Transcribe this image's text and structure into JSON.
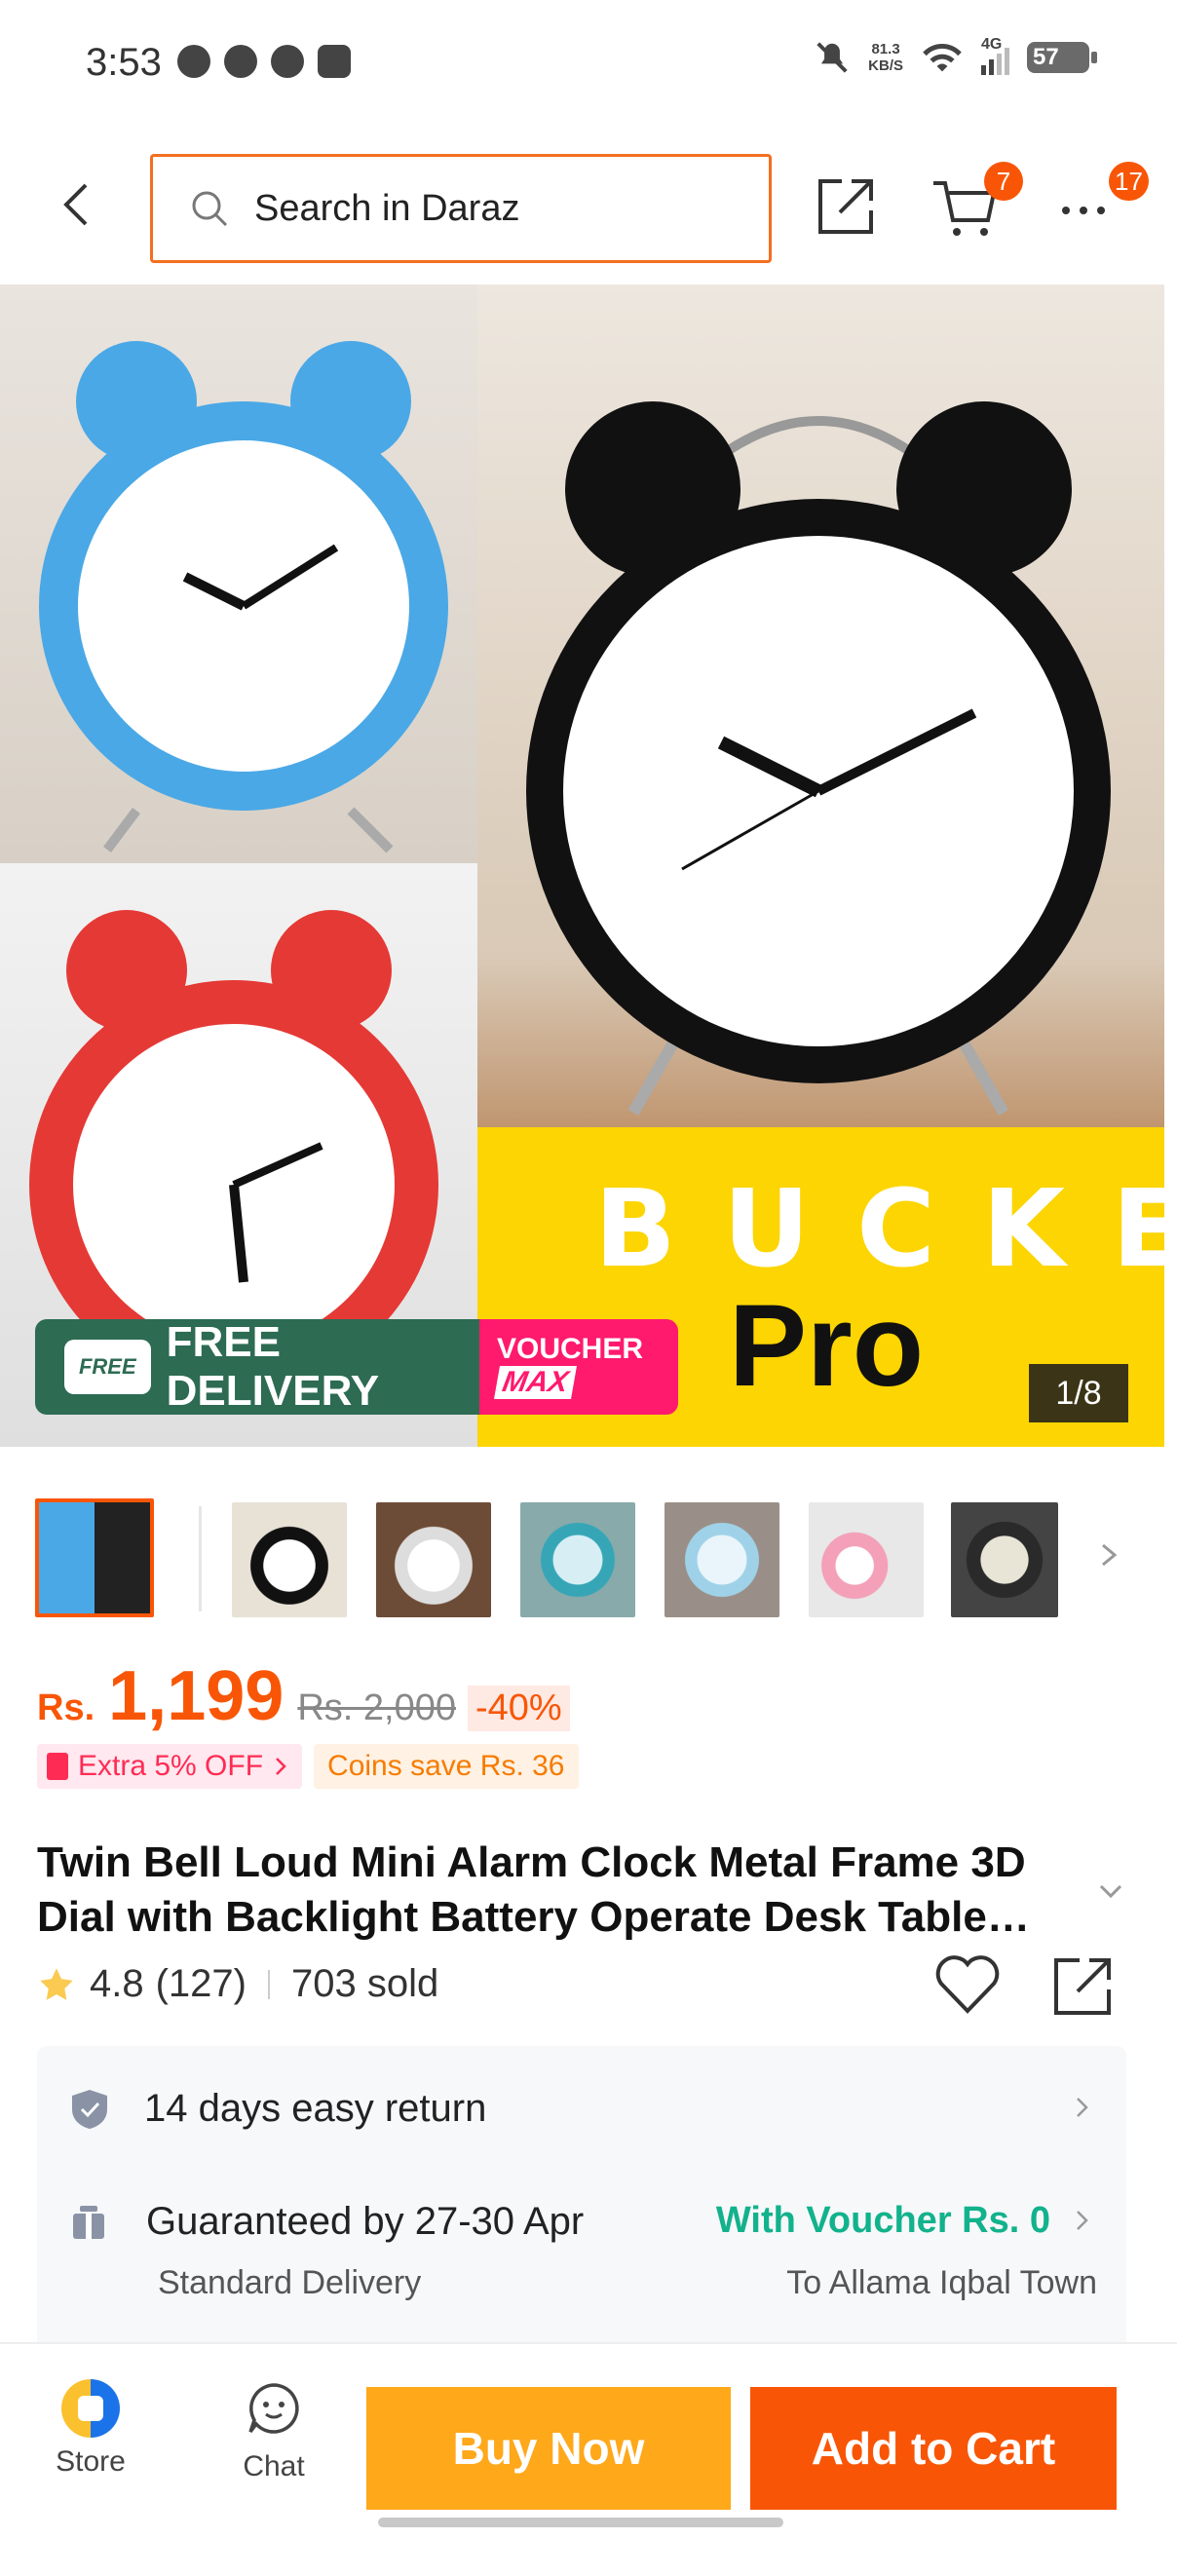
{
  "status_bar": {
    "time": "3:53",
    "net_speed_value": "81.3",
    "net_speed_unit": "KB/S",
    "network": "4G",
    "battery": "57"
  },
  "header": {
    "search_placeholder": "Search in Daraz",
    "cart_badge": "7",
    "more_badge": "17"
  },
  "gallery": {
    "banner_word": "BUCKET",
    "banner_sub": "Pro",
    "free_delivery_tag": "FREE",
    "free_delivery": "FREE DELIVERY",
    "voucher_line1": "VOUCHER",
    "voucher_line2": "MAX",
    "counter": "1/8"
  },
  "product": {
    "currency": "Rs.",
    "price": "1,199",
    "old_price": "Rs. 2,000",
    "discount": "-40%",
    "promo_extra": "Extra 5% OFF",
    "promo_coins": "Coins save Rs. 36",
    "title": "Twin Bell Loud Mini Alarm Clock Metal Frame 3D Dial with Backlight Battery Operate Desk Table Clock",
    "rating": "4.8",
    "reviews": "(127)",
    "sold": "703 sold"
  },
  "services": {
    "return_text": "14 days easy return",
    "delivery_text": "Guaranteed by 27-30 Apr",
    "voucher_text": "With Voucher Rs. 0",
    "delivery_type": "Standard Delivery",
    "location": "To Allama Iqbal Town"
  },
  "bottom_bar": {
    "store_label": "Store",
    "chat_label": "Chat",
    "buy_now": "Buy Now",
    "add_to_cart": "Add to Cart"
  },
  "colors": {
    "accent": "#f85606",
    "buy_now": "#fea81a",
    "voucher_green": "#12b28c"
  }
}
